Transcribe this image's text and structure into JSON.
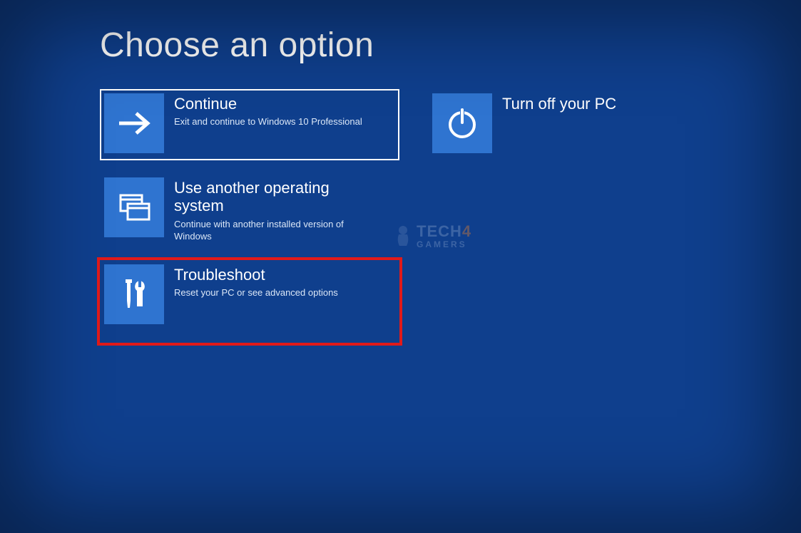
{
  "header": {
    "title": "Choose an option"
  },
  "options": {
    "continue": {
      "title": "Continue",
      "desc": "Exit and continue to Windows 10 Professional",
      "icon": "arrow-right-icon"
    },
    "use_another": {
      "title": "Use another operating system",
      "desc": "Continue with another installed version of Windows",
      "icon": "windows-stack-icon"
    },
    "troubleshoot": {
      "title": "Troubleshoot",
      "desc": "Reset your PC or see advanced options",
      "icon": "tools-icon"
    },
    "turn_off": {
      "title": "Turn off your PC",
      "desc": "",
      "icon": "power-icon"
    }
  },
  "watermark": {
    "brand_main": "TECH",
    "brand_four": "4",
    "brand_sub": "GAMERS"
  },
  "colors": {
    "background": "#0f3f8d",
    "tile": "#2f74d0",
    "highlight": "#e11a1a"
  }
}
